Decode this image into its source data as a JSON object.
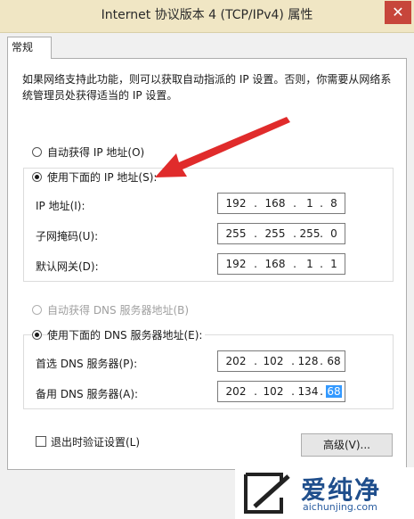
{
  "window": {
    "title": "Internet 协议版本 4 (TCP/IPv4) 属性",
    "close_glyph": "✕"
  },
  "tabs": [
    {
      "label": "常规"
    }
  ],
  "description": "如果网络支持此功能，则可以获取自动指派的 IP 设置。否则，你需要从网络系统管理员处获得适当的 IP 设置。",
  "ip": {
    "auto_label": "自动获得 IP 地址(O)",
    "auto_checked": false,
    "manual_label": "使用下面的 IP 地址(S):",
    "manual_checked": true,
    "address_label": "IP 地址(I):",
    "address": [
      "192",
      "168",
      "1",
      "8"
    ],
    "subnet_label": "子网掩码(U):",
    "subnet": [
      "255",
      "255",
      "255",
      "0"
    ],
    "gateway_label": "默认网关(D):",
    "gateway": [
      "192",
      "168",
      "1",
      "1"
    ]
  },
  "dns": {
    "auto_label": "自动获得 DNS 服务器地址(B)",
    "auto_checked": false,
    "auto_disabled": true,
    "manual_label": "使用下面的 DNS 服务器地址(E):",
    "manual_checked": true,
    "preferred_label": "首选 DNS 服务器(P):",
    "preferred": [
      "202",
      "102",
      "128",
      "68"
    ],
    "alternate_label": "备用 DNS 服务器(A):",
    "alternate": [
      "202",
      "102",
      "134",
      "68"
    ],
    "alternate_selected_octet": 3
  },
  "validate": {
    "label": "退出时验证设置(L)",
    "checked": false
  },
  "buttons": {
    "advanced": "高级(V)..."
  },
  "annotation": {
    "arrow_color": "#e02b2b"
  },
  "watermark": {
    "brand": "爱纯净",
    "url": "aichunjing.com",
    "logo_icon": "square-slash-logo"
  }
}
